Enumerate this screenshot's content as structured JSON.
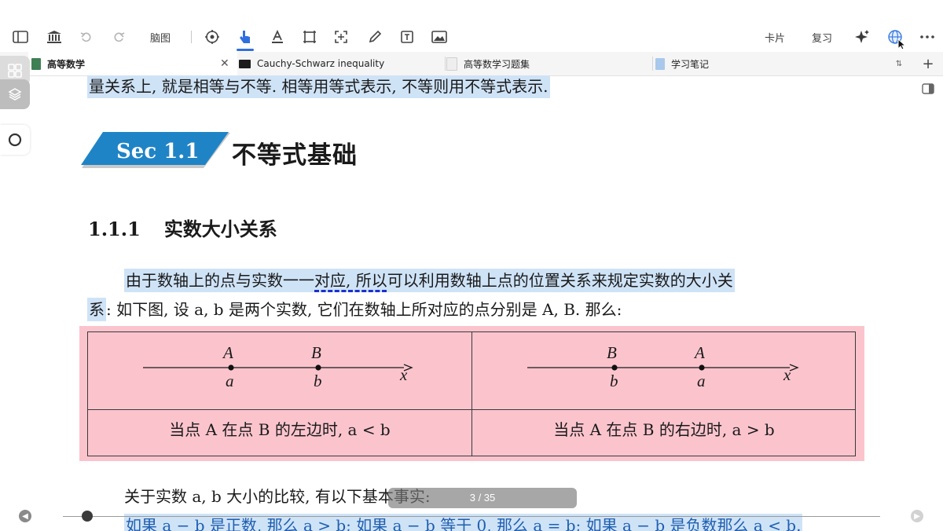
{
  "toolbar": {
    "mindmap_label": "脑图",
    "cards_label": "卡片",
    "review_label": "复习"
  },
  "tabs": [
    {
      "label": "高等数学",
      "active": true
    },
    {
      "label": "Cauchy-Schwarz inequality",
      "active": false
    },
    {
      "label": "高等数学习题集",
      "active": false
    },
    {
      "label": "学习笔记",
      "active": false
    }
  ],
  "document": {
    "top_line": "量关系上, 就是相等与不等. 相等用等式表示, 不等则用不等式表示.",
    "section_badge": "Sec 1.1",
    "section_title": "不等式基础",
    "subsection_number": "1.1.1",
    "subsection_title": "实数大小关系",
    "para1_highlight": "由于数轴上的点与实数一一对应, 所以可以利用数轴上点的位置关系来规定实数的大小关",
    "para2_highlight": "系",
    "para2_rest": ": 如下图, 设 a, b 是两个实数, 它们在数轴上所对应的点分别是 A, B. 那么:",
    "figure": {
      "left": {
        "upper": [
          "A",
          "B"
        ],
        "lower": [
          "a",
          "b"
        ],
        "axis": "x",
        "caption": "当点 A 在点 B 的左边时, a < b"
      },
      "right": {
        "upper": [
          "B",
          "A"
        ],
        "lower": [
          "b",
          "a"
        ],
        "axis": "x",
        "caption": "当点 A 在点 B 的右边时, a > b"
      }
    },
    "para3": "关于实数 a, b 大小的比较, 有以下基本事实:",
    "para4": "如果 a − b 是正数, 那么 a > b; 如果 a − b 等于 0, 那么 a = b; 如果 a − b 是负数那么 a < b."
  },
  "pager": {
    "text": "3 / 35"
  },
  "colors": {
    "accent": "#2f6fe0",
    "highlight": "#cfe3f7",
    "figure_bg": "#fbc4cd",
    "badge": "#1f84c6"
  }
}
